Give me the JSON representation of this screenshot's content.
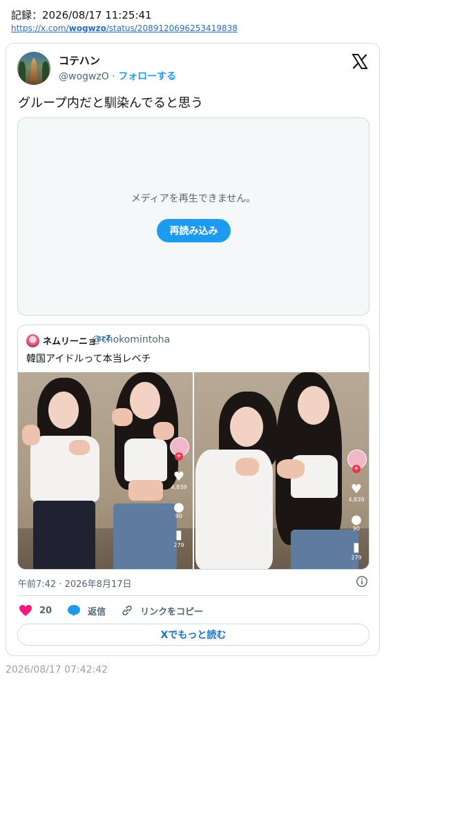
{
  "record": {
    "title": "記録：2026/08/17 11:25:41",
    "url_prefix": "https://x.com/",
    "url_user": "wogwzo",
    "url_suffix": "/status/2089120696253419838"
  },
  "tweet": {
    "display_name": "コテハン",
    "handle": "@wogwzO",
    "separator": "·",
    "follow_label": "フォローする",
    "text": "グループ内だと馴染んでると思う",
    "media": {
      "message": "メディアを再生できません。",
      "reload_label": "再読み込み"
    },
    "quote": {
      "name": "ネムリーニョ",
      "name_suffix": "zzZ",
      "handle": "@chokomintoha",
      "text": "韓国アイドルって本当レベチ",
      "left_stats": {
        "likes": "4,839",
        "comments": "90",
        "saves": "279"
      },
      "right_stats": {
        "likes": "4,839",
        "comments": "90",
        "saves": "279"
      }
    },
    "timestamp": "午前7:42 · 2026年8月17日",
    "actions": {
      "like_count": "20",
      "reply_label": "返信",
      "copy_label": "リンクをコピー"
    },
    "read_more_label": "Xでもっと読む"
  },
  "footer_time": "2026/08/17 07:42:42",
  "colors": {
    "accent": "#1d9bf0",
    "like": "#f91880",
    "text_secondary": "#536471"
  },
  "icons": [
    "x-logo-icon",
    "info-icon",
    "heart-icon",
    "reply-bubble-icon",
    "link-icon"
  ]
}
